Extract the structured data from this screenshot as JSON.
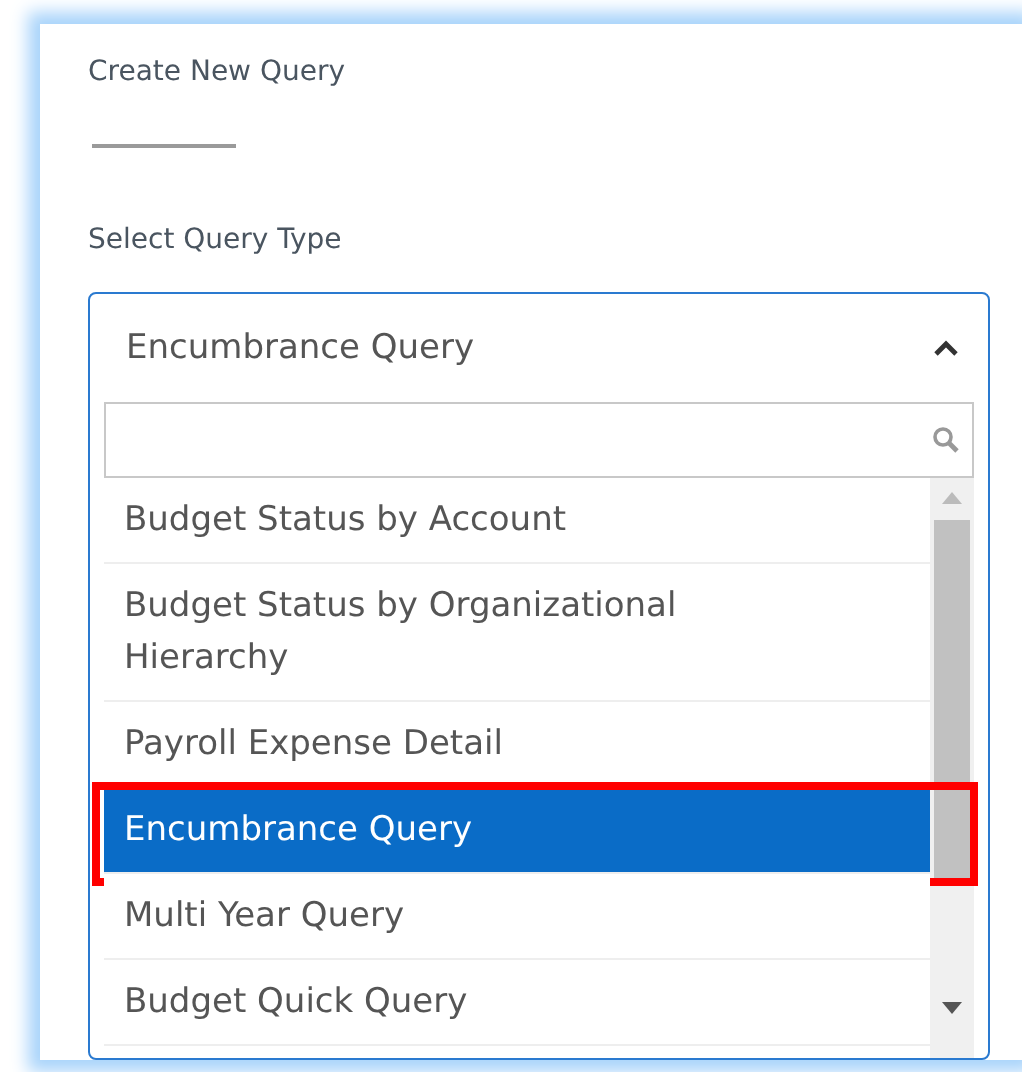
{
  "title": "Create New Query",
  "field_label": "Select Query Type",
  "select": {
    "value": "Encumbrance Query",
    "expanded": true
  },
  "options": [
    {
      "label": "Budget Status by Account",
      "selected": false
    },
    {
      "label": "Budget Status by Organizational Hierarchy",
      "selected": false
    },
    {
      "label": "Payroll Expense Detail",
      "selected": false
    },
    {
      "label": "Encumbrance Query",
      "selected": true
    },
    {
      "label": "Multi Year Query",
      "selected": false
    },
    {
      "label": "Budget Quick Query",
      "selected": false
    }
  ]
}
